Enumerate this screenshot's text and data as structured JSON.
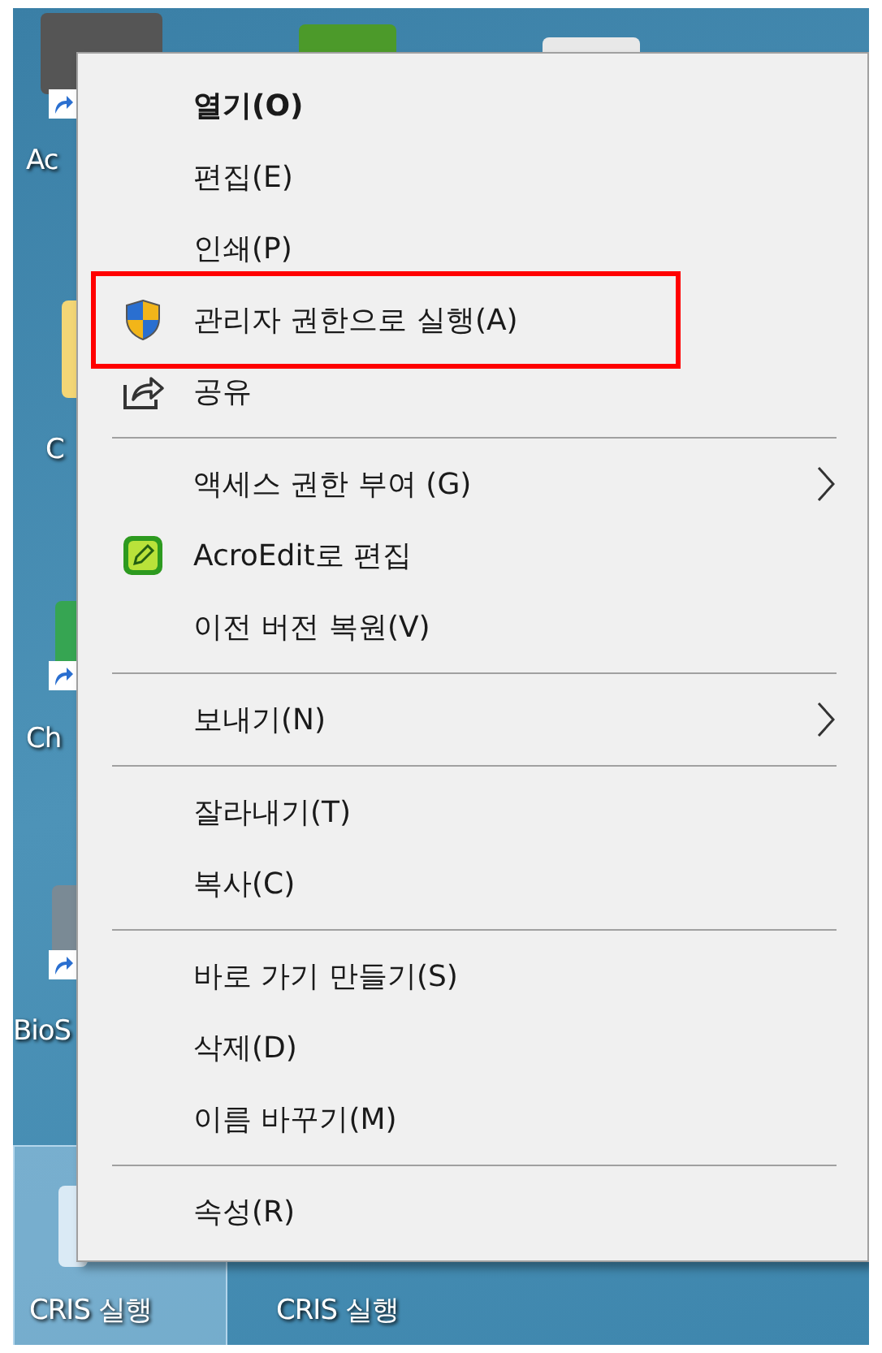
{
  "desktop_icons": [
    {
      "label": "Ac",
      "selected": false
    },
    {
      "label": "C",
      "selected": false
    },
    {
      "label": "Ch",
      "selected": false
    },
    {
      "label": "BioS",
      "selected": false
    },
    {
      "label": "CRIS 실행",
      "selected": true
    },
    {
      "label": "CRIS 실행",
      "selected": false
    }
  ],
  "context_menu": {
    "items": [
      {
        "kind": "item",
        "label": "열기(O)",
        "default": true
      },
      {
        "kind": "item",
        "label": "편집(E)"
      },
      {
        "kind": "item",
        "label": "인쇄(P)"
      },
      {
        "kind": "item",
        "label": "관리자 권한으로 실행(A)",
        "highlighted": true
      },
      {
        "kind": "item",
        "label": "공유"
      },
      {
        "kind": "separator"
      },
      {
        "kind": "item",
        "label": "액세스 권한 부여 (G)",
        "submenu": true
      },
      {
        "kind": "item",
        "label": "AcroEdit로 편집"
      },
      {
        "kind": "item",
        "label": "이전 버전 복원(V)"
      },
      {
        "kind": "separator"
      },
      {
        "kind": "item",
        "label": "보내기(N)",
        "submenu": true
      },
      {
        "kind": "separator"
      },
      {
        "kind": "item",
        "label": "잘라내기(T)"
      },
      {
        "kind": "item",
        "label": "복사(C)"
      },
      {
        "kind": "separator"
      },
      {
        "kind": "item",
        "label": "바로 가기 만들기(S)"
      },
      {
        "kind": "item",
        "label": "삭제(D)"
      },
      {
        "kind": "item",
        "label": "이름 바꾸기(M)"
      },
      {
        "kind": "separator"
      },
      {
        "kind": "item",
        "label": "속성(R)"
      }
    ]
  }
}
